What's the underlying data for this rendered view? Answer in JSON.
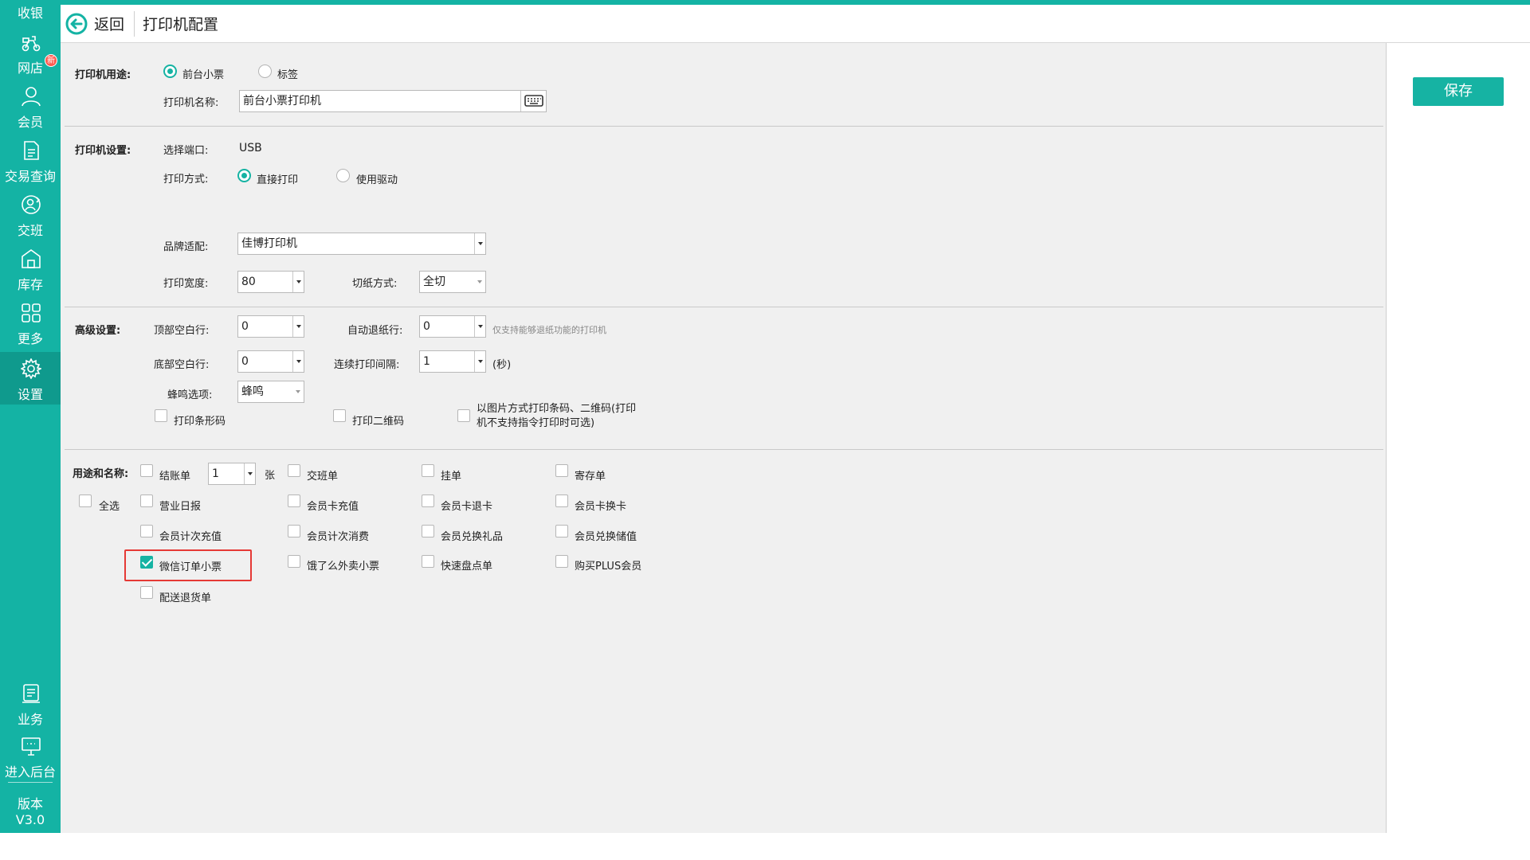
{
  "colors": {
    "accent": "#14b3a4",
    "highlight": "#e53935"
  },
  "sidebar": {
    "top_label": "收银",
    "items": [
      {
        "label": "网店",
        "icon": "scooter-icon",
        "badge": "新"
      },
      {
        "label": "会员",
        "icon": "user-icon"
      },
      {
        "label": "交易查询",
        "icon": "document-icon"
      },
      {
        "label": "交班",
        "icon": "user-swap-icon"
      },
      {
        "label": "库存",
        "icon": "warehouse-icon"
      },
      {
        "label": "更多",
        "icon": "grid-icon"
      },
      {
        "label": "设置",
        "icon": "gear-icon",
        "active": true
      },
      {
        "label": "业务",
        "icon": "ledger-icon"
      },
      {
        "label": "进入后台",
        "icon": "monitor-icon"
      }
    ],
    "version_label": "版本",
    "version_value": "V3.0"
  },
  "header": {
    "back_label": "返回",
    "title": "打印机配置"
  },
  "save_label": "保存",
  "usage": {
    "section_label": "打印机用途:",
    "options": [
      "前台小票",
      "标签"
    ],
    "selected": "前台小票",
    "name_label": "打印机名称:",
    "name_value": "前台小票打印机"
  },
  "settings": {
    "section_label": "打印机设置:",
    "port_label": "选择端口:",
    "port_value": "USB",
    "mode_label": "打印方式:",
    "mode_options": [
      "直接打印",
      "使用驱动"
    ],
    "mode_selected": "直接打印",
    "brand_label": "品牌适配:",
    "brand_value": "佳博打印机",
    "width_label": "打印宽度:",
    "width_value": "80",
    "cut_label": "切纸方式:",
    "cut_value": "全切"
  },
  "advanced": {
    "section_label": "高级设置:",
    "top_blank_label": "顶部空白行:",
    "top_blank_value": "0",
    "auto_feed_label": "自动退纸行:",
    "auto_feed_value": "0",
    "auto_feed_hint": "仅支持能够退纸功能的打印机",
    "bottom_blank_label": "底部空白行:",
    "bottom_blank_value": "0",
    "interval_label": "连续打印间隔:",
    "interval_value": "1",
    "interval_unit": "(秒)",
    "beep_label": "蜂鸣选项:",
    "beep_value": "蜂鸣",
    "print_barcode": "打印条形码",
    "print_qrcode": "打印二维码",
    "image_mode_line1": "以图片方式打印条码、二维码(打印",
    "image_mode_line2": "机不支持指令打印时可选)"
  },
  "purposes": {
    "section_label": "用途和名称:",
    "select_all": "全选",
    "copies_value": "1",
    "copies_unit": "张",
    "items": {
      "checkout": "结账单",
      "shift": "交班单",
      "hold": "挂单",
      "deposit": "寄存单",
      "daily_report": "营业日报",
      "card_recharge": "会员卡充值",
      "card_refund": "会员卡退卡",
      "card_exchange": "会员卡换卡",
      "count_recharge": "会员计次充值",
      "count_consume": "会员计次消费",
      "gift_exchange": "会员兑换礼品",
      "stored_exchange": "会员兑换储值",
      "wechat_order": "微信订单小票",
      "eleme": "饿了么外卖小票",
      "quick_stock": "快速盘点单",
      "plus_member": "购买PLUS会员",
      "delivery_return": "配送退货单"
    },
    "checked": [
      "wechat_order"
    ]
  }
}
